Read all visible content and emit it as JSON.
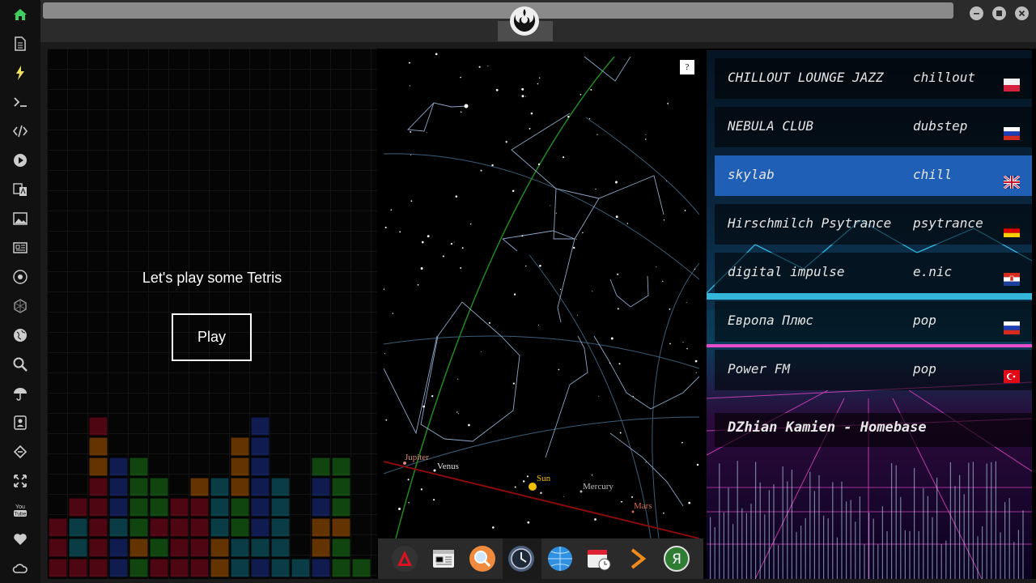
{
  "sidebar": {
    "items": [
      {
        "icon": "home-icon",
        "color": "#3fcf5f"
      },
      {
        "icon": "document-icon"
      },
      {
        "icon": "lightning-icon",
        "color": "#f0e060"
      },
      {
        "icon": "terminal-icon"
      },
      {
        "icon": "code-icon"
      },
      {
        "icon": "play-circle-icon"
      },
      {
        "icon": "translate-icon"
      },
      {
        "icon": "image-icon"
      },
      {
        "icon": "news-icon"
      },
      {
        "icon": "rebel-icon"
      },
      {
        "icon": "hexagon-icon"
      },
      {
        "icon": "globe-icon"
      },
      {
        "icon": "search-icon"
      },
      {
        "icon": "umbrella-icon"
      },
      {
        "icon": "contacts-icon"
      },
      {
        "icon": "link-icon"
      },
      {
        "icon": "fullscreen-icon"
      },
      {
        "icon": "youtube-icon",
        "label": "You\nTube"
      },
      {
        "icon": "heart-icon"
      },
      {
        "icon": "cloud-icon"
      }
    ]
  },
  "tetris": {
    "title": "Let's play some Tetris",
    "play_label": "Play"
  },
  "sky": {
    "help_label": "?",
    "planets": [
      {
        "name": "Jupiter",
        "color": "#d48a7a"
      },
      {
        "name": "Venus",
        "color": "#e6e6e6"
      },
      {
        "name": "Sun",
        "color": "#f0c000"
      },
      {
        "name": "Mercury",
        "color": "#bbbbbb"
      },
      {
        "name": "Mars",
        "color": "#d46a50"
      }
    ]
  },
  "dock": {
    "items": [
      "pdf-app-icon",
      "calendar-doc-icon",
      "search-app-icon",
      "clock-app-icon",
      "globe-app-icon",
      "calendar-clock-icon",
      "arrow-app-icon",
      "yandex-icon"
    ]
  },
  "radio": {
    "stations": [
      {
        "name": "CHILLOUT LOUNGE JAZZ",
        "genre": "chillout",
        "flag": "pl"
      },
      {
        "name": "NEBULA CLUB",
        "genre": "dubstep",
        "flag": "ru"
      },
      {
        "name": "skylab",
        "genre": "chill",
        "flag": "gb",
        "active": true
      },
      {
        "name": "Hirschmilch Psytrance",
        "genre": "psytrance",
        "flag": "de"
      },
      {
        "name": "digital impulse",
        "genre": "e.nic",
        "flag": "hr"
      },
      {
        "name": "Европа Плюс",
        "genre": "pop",
        "flag": "ru"
      },
      {
        "name": "Power FM",
        "genre": "pop",
        "flag": "tr"
      }
    ],
    "now_playing": "DZhian Kamien - Homebase"
  }
}
